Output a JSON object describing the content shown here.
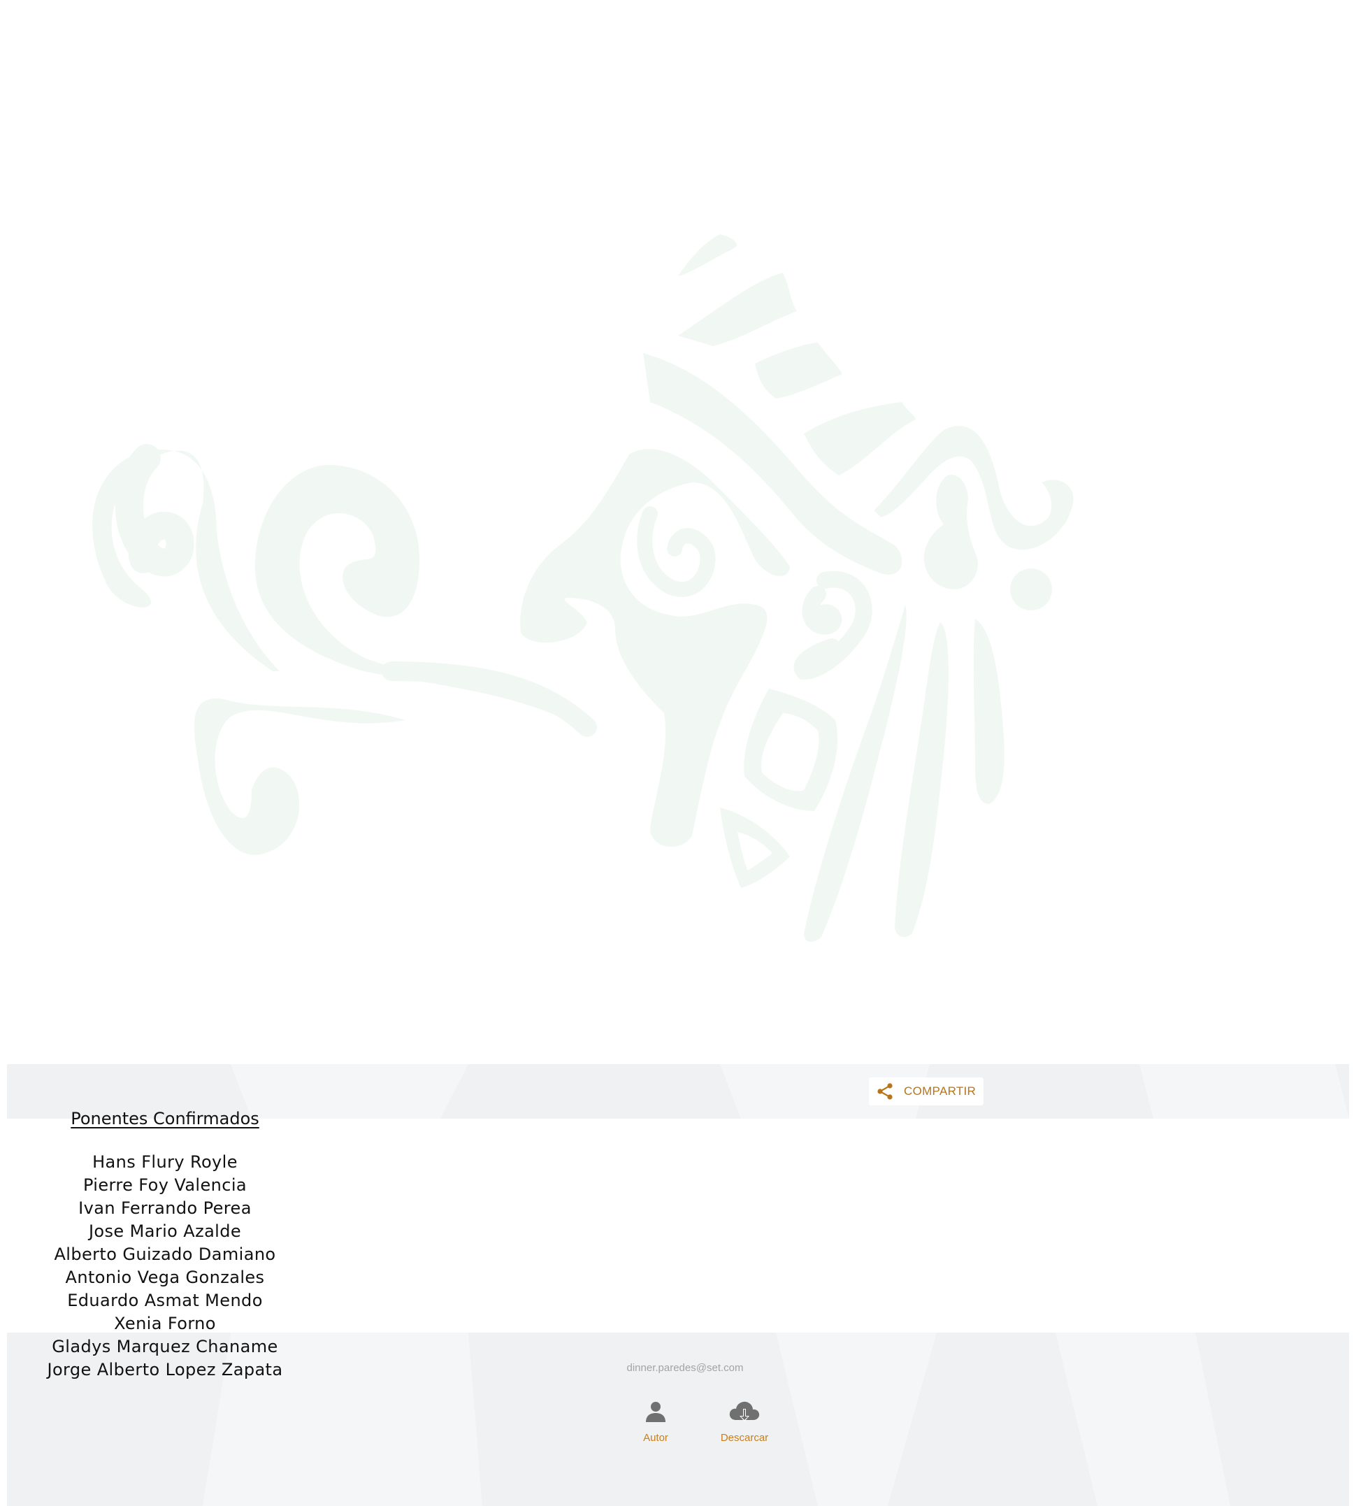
{
  "share": {
    "label": "COMPARTIR",
    "icon": "share-icon",
    "accent_color": "#b87418"
  },
  "content": {
    "heading": "Ponentes Confirmados",
    "speakers": [
      "Hans Flury Royle",
      "Pierre Foy Valencia",
      "Ivan Ferrando Perea",
      "Jose Mario Azalde",
      "Alberto Guizado Damiano",
      "Antonio Vega Gonzales",
      "Eduardo Asmat Mendo",
      "Xenia Forno",
      "Gladys Marquez Chaname",
      "Jorge Alberto Lopez Zapata"
    ]
  },
  "footer": {
    "email": "dinner.paredes@set.com",
    "actions": [
      {
        "label": "Autor",
        "icon": "user-icon"
      },
      {
        "label": "Descarcar",
        "icon": "cloud-download-icon"
      }
    ],
    "accent_color": "#c77f1b"
  },
  "colors": {
    "watermark": "#f1f8f3",
    "band_background": "#f0f1f2"
  }
}
